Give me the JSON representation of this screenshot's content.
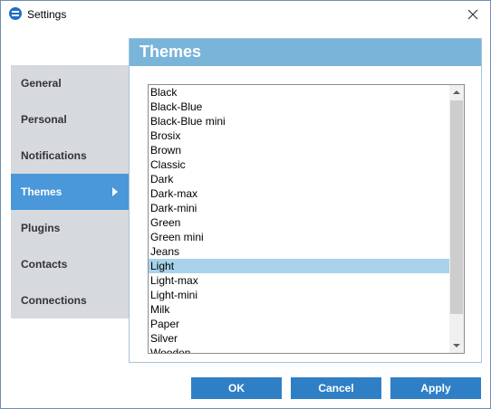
{
  "window": {
    "title": "Settings",
    "icon": "app-logo-icon",
    "close_icon": "close-icon"
  },
  "sidebar": {
    "items": [
      {
        "label": "General",
        "active": false
      },
      {
        "label": "Personal",
        "active": false
      },
      {
        "label": "Notifications",
        "active": false
      },
      {
        "label": "Themes",
        "active": true
      },
      {
        "label": "Plugins",
        "active": false
      },
      {
        "label": "Contacts",
        "active": false
      },
      {
        "label": "Connections",
        "active": false
      }
    ]
  },
  "panel": {
    "title": "Themes",
    "header_color": "#79b4d9"
  },
  "themes_list": {
    "selected": "Light",
    "items": [
      "Black",
      "Black-Blue",
      "Black-Blue mini",
      "Brosix",
      "Brown",
      "Classic",
      "Dark",
      "Dark-max",
      "Dark-mini",
      "Green",
      "Green mini",
      "Jeans",
      "Light",
      "Light-max",
      "Light-mini",
      "Milk",
      "Paper",
      "Silver",
      "Wooden"
    ]
  },
  "buttons": {
    "ok": "OK",
    "cancel": "Cancel",
    "apply": "Apply"
  },
  "colors": {
    "accent": "#2f7fc6",
    "nav_active": "#4a97d9",
    "selection": "#a8d3ea"
  }
}
